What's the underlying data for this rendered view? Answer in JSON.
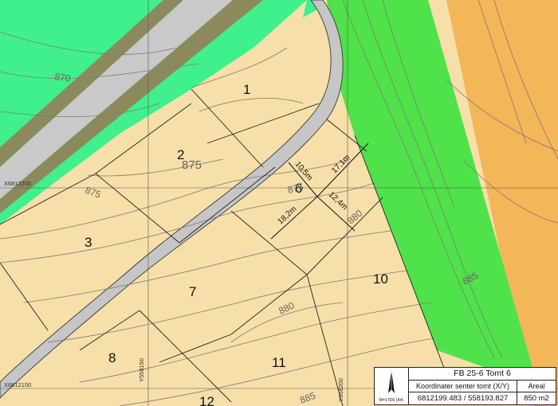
{
  "map": {
    "plots": [
      "1",
      "2",
      "3",
      "6",
      "7",
      "8",
      "10",
      "11",
      "12"
    ],
    "contours": [
      "870",
      "875",
      "875",
      "875",
      "880",
      "880",
      "885",
      "885"
    ],
    "dimensions": [
      "10,5m",
      "17,1m",
      "12,4m",
      "18,2m"
    ],
    "grid_labels": [
      "X6812200",
      "X6812150",
      "Y558150",
      "Y558200"
    ],
    "colors": {
      "plot_fill": "#f7dfa9",
      "green_zone": "#3ff08c",
      "bright_green_zone": "#4fe24a",
      "orange_zone": "#f3b659",
      "road_grey": "#c9c9c9",
      "road_olive": "#8c8a5c",
      "contour": "#7a7a7a"
    }
  },
  "title_block": {
    "scale": "M=1:500 (A4)",
    "title": "FB 25-6 Tomt 6",
    "coord_label": "Koordinater senter tomt (X/Y)",
    "area_label": "Areal",
    "coord_value": "6812199.483 / 558193.827",
    "area_value": "850 m2"
  }
}
